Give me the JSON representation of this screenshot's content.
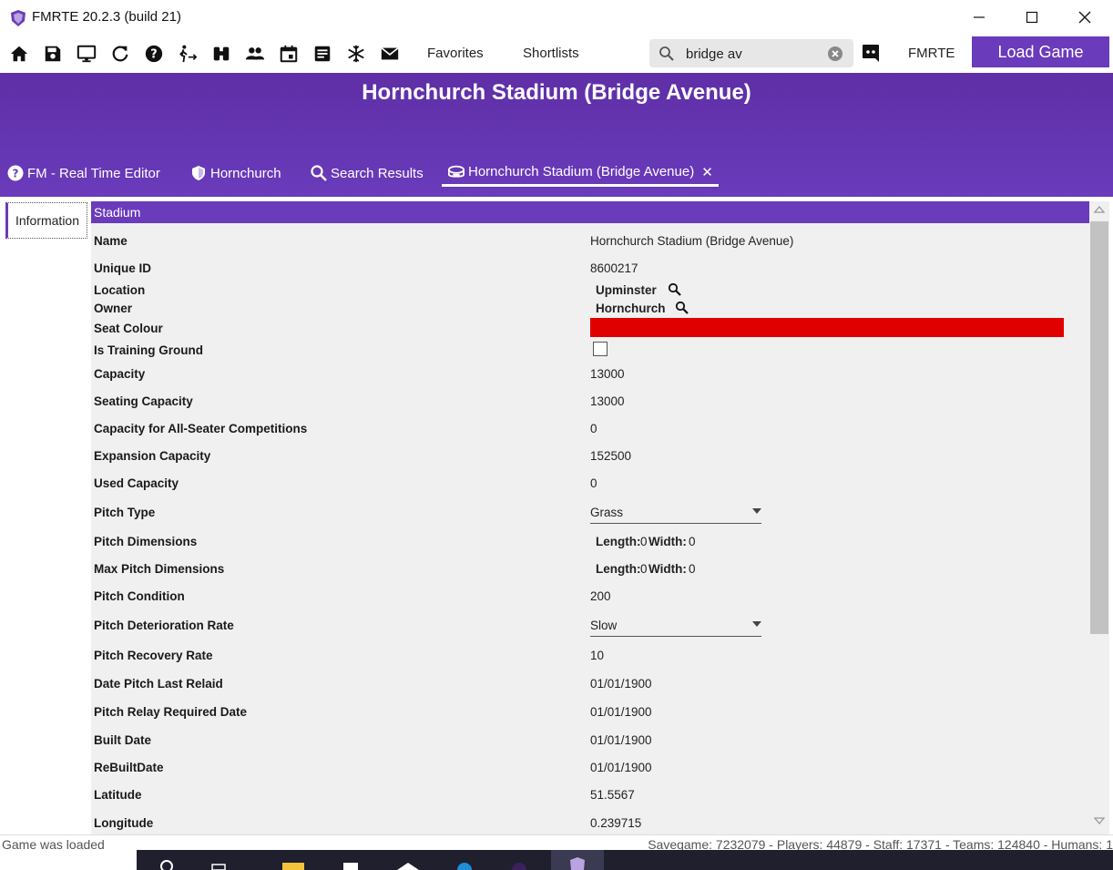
{
  "window": {
    "title": "FMRTE 20.2.3 (build 21)"
  },
  "toolbar": {
    "icons": [
      "home-icon",
      "save-icon",
      "monitor-icon",
      "refresh-icon",
      "help-icon",
      "transfer-icon",
      "binoculars-icon",
      "people-icon",
      "calendar-icon",
      "notes-icon",
      "snowflake-icon",
      "mail-icon"
    ],
    "favorites_label": "Favorites",
    "shortlists_label": "Shortlists",
    "search_value": "bridge av",
    "fmrte_label": "FMRTE",
    "load_game_label": "Load Game"
  },
  "header": {
    "title": "Hornchurch Stadium (Bridge Avenue)",
    "tabs": [
      {
        "label": "FM - Real Time Editor",
        "icon": "help-circle-icon"
      },
      {
        "label": "Hornchurch",
        "icon": "shield-icon"
      },
      {
        "label": "Search Results",
        "icon": "search-icon"
      },
      {
        "label": "Hornchurch Stadium (Bridge Avenue)",
        "icon": "stadium-icon",
        "active": true
      }
    ]
  },
  "nav": {
    "information_label": "Information"
  },
  "section": {
    "title": "Stadium"
  },
  "colors": {
    "accent": "#6a3bbb",
    "seat_colour": "#e00000"
  },
  "fields": {
    "name": {
      "label": "Name",
      "value": "Hornchurch Stadium (Bridge Avenue)"
    },
    "unique_id": {
      "label": "Unique ID",
      "value": "8600217"
    },
    "location": {
      "label": "Location",
      "value": "Upminster"
    },
    "owner": {
      "label": "Owner",
      "value": "Hornchurch"
    },
    "seat_colour": {
      "label": "Seat Colour"
    },
    "training_ground": {
      "label": "Is Training Ground",
      "checked": false
    },
    "capacity": {
      "label": "Capacity",
      "value": "13000"
    },
    "seating_capacity": {
      "label": "Seating Capacity",
      "value": "13000"
    },
    "all_seater": {
      "label": "Capacity for All-Seater Competitions",
      "value": "0"
    },
    "expansion": {
      "label": "Expansion Capacity",
      "value": "152500"
    },
    "used": {
      "label": "Used Capacity",
      "value": "0"
    },
    "pitch_type": {
      "label": "Pitch Type",
      "value": "Grass"
    },
    "pitch_dims": {
      "label": "Pitch Dimensions",
      "length_label": "Length:",
      "length": "0",
      "width_label": "Width:",
      "width": "0"
    },
    "max_pitch_dims": {
      "label": "Max Pitch Dimensions",
      "length_label": "Length:",
      "length": "0",
      "width_label": "Width:",
      "width": "0"
    },
    "pitch_condition": {
      "label": "Pitch Condition",
      "value": "200"
    },
    "deterioration": {
      "label": "Pitch Deterioration Rate",
      "value": "Slow"
    },
    "recovery": {
      "label": "Pitch Recovery Rate",
      "value": "10"
    },
    "last_relaid": {
      "label": "Date Pitch Last Relaid",
      "value": "01/01/1900"
    },
    "relay_required": {
      "label": "Pitch Relay Required Date",
      "value": "01/01/1900"
    },
    "built": {
      "label": "Built Date",
      "value": "01/01/1900"
    },
    "rebuilt": {
      "label": "ReBuiltDate",
      "value": "01/01/1900"
    },
    "latitude": {
      "label": "Latitude",
      "value": "51.5567"
    },
    "longitude": {
      "label": "Longitude",
      "value": "0.239715"
    }
  },
  "status": {
    "left": "Game was loaded",
    "right": "Savegame: 7232079 - Players: 44879 - Staff: 17371 - Teams: 124840 - Humans: 1"
  }
}
